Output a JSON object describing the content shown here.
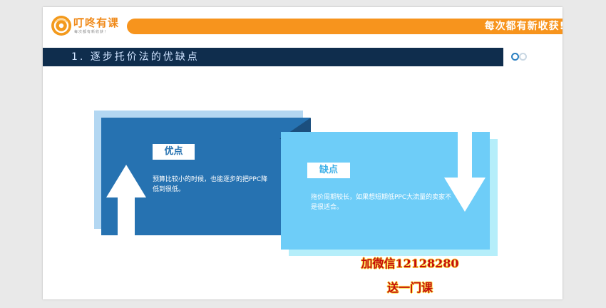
{
  "header": {
    "brand_name": "叮咚有课",
    "brand_tagline": "每次都有新收获！",
    "slogan": "每次都有新收获!"
  },
  "slide": {
    "title": "1. 逐步托价法的优缺点",
    "pagination_dots": 2,
    "pros": {
      "label": "优点",
      "text": "预算比较小的时候，也能逐步的把PPC降低到很低。"
    },
    "cons": {
      "label": "缺点",
      "text": "拖价周期较长，如果想短期低PPC大流量的卖家不是很适合。"
    }
  },
  "watermark": {
    "line1": "加微信12128280",
    "line2": "送一门课"
  },
  "colors": {
    "accent_orange": "#f7941d",
    "title_bar": "#0f2d4d",
    "pros_blue": "#2672b1",
    "cons_blue": "#6ecdf8",
    "watermark_red": "#c40d0d"
  },
  "icons": {
    "logo": "brand-logo-icon",
    "pros_arrow": "arrow-up-icon",
    "cons_arrow": "arrow-down-icon"
  }
}
